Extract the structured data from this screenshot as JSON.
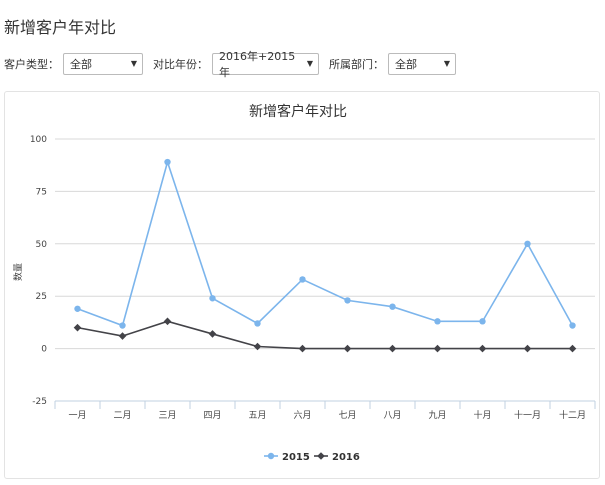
{
  "page": {
    "title": "新增客户年对比"
  },
  "filters": {
    "customer_type": {
      "label": "客户类型：",
      "value": "全部"
    },
    "compare_year": {
      "label": "对比年份：",
      "value": "2016年+2015年"
    },
    "department": {
      "label": "所属部门：",
      "value": "全部"
    }
  },
  "chart_data": {
    "type": "line",
    "title": "新增客户年对比",
    "ylabel": "数量",
    "xlabel": "",
    "categories": [
      "一月",
      "二月",
      "三月",
      "四月",
      "五月",
      "六月",
      "七月",
      "八月",
      "九月",
      "十月",
      "十一月",
      "十二月"
    ],
    "ylim": [
      -25,
      100
    ],
    "yticks": [
      -25,
      0,
      25,
      50,
      75,
      100
    ],
    "grid": true,
    "legend_position": "bottom-center",
    "series": [
      {
        "name": "2015",
        "color": "#7cb5ec",
        "marker": "circle",
        "values": [
          19,
          11,
          89,
          24,
          12,
          33,
          23,
          20,
          13,
          13,
          50,
          11
        ]
      },
      {
        "name": "2016",
        "color": "#434348",
        "marker": "diamond",
        "values": [
          10,
          6,
          13,
          7,
          1,
          0,
          0,
          0,
          0,
          0,
          0,
          0
        ]
      }
    ]
  }
}
